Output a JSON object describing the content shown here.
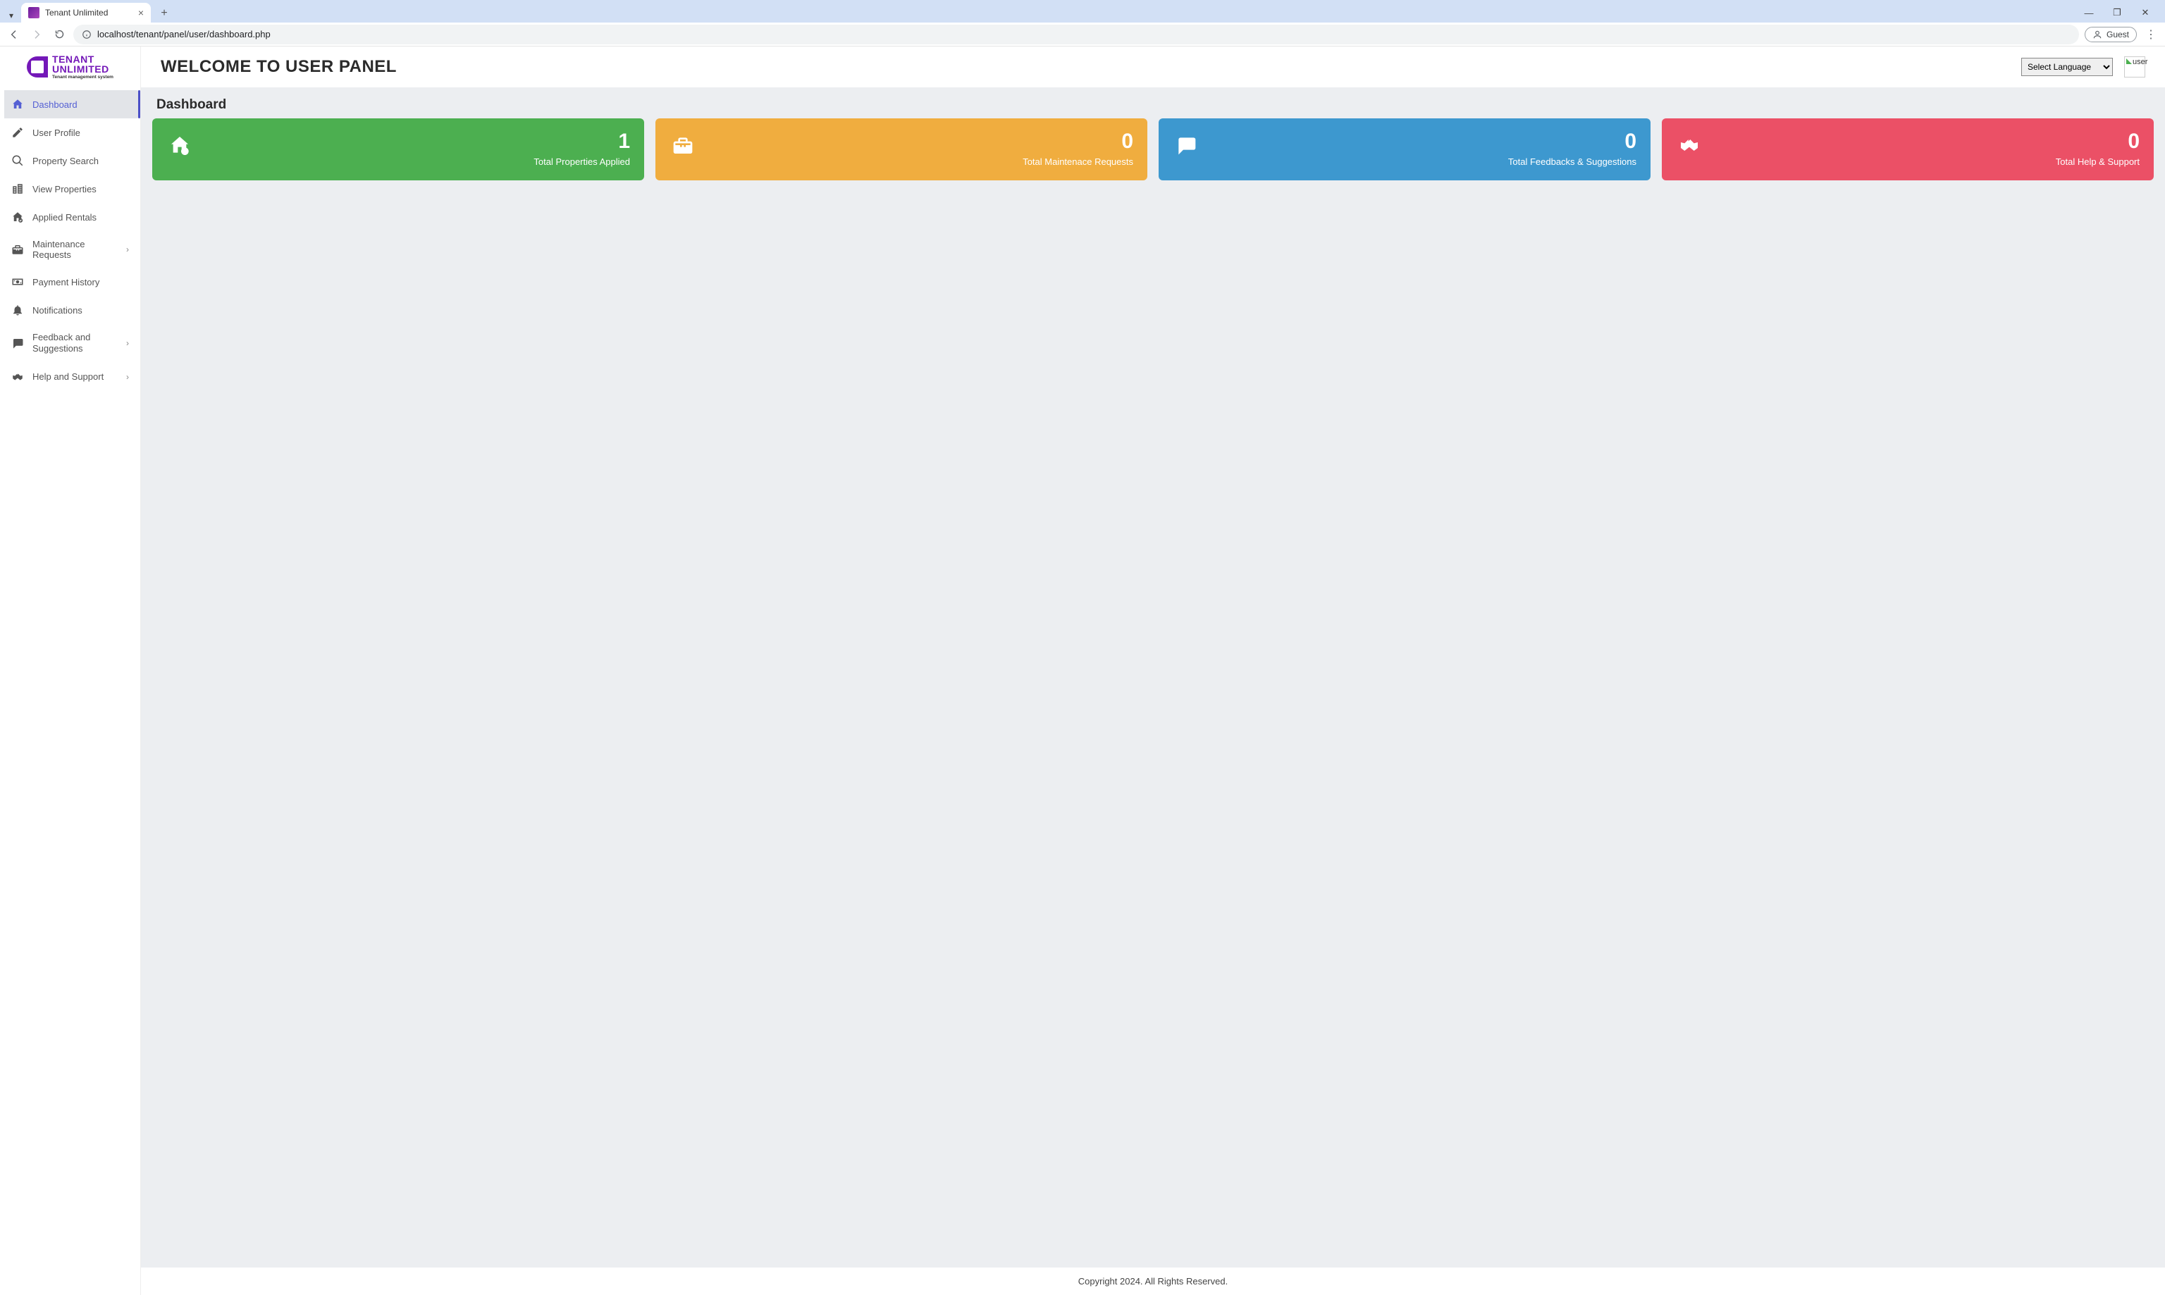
{
  "browser": {
    "tab_title": "Tenant Unlimited",
    "url": "localhost/tenant/panel/user/dashboard.php",
    "guest_label": "Guest"
  },
  "logo": {
    "line1": "TENANT",
    "line2": "UNLIMITED",
    "tagline": "Tenant management system"
  },
  "sidebar": {
    "items": [
      {
        "label": "Dashboard",
        "icon": "home-icon",
        "active": true,
        "has_submenu": false
      },
      {
        "label": "User Profile",
        "icon": "pencil-icon",
        "active": false,
        "has_submenu": false
      },
      {
        "label": "Property Search",
        "icon": "search-icon",
        "active": false,
        "has_submenu": false
      },
      {
        "label": "View Properties",
        "icon": "buildings-icon",
        "active": false,
        "has_submenu": false
      },
      {
        "label": "Applied Rentals",
        "icon": "home-check-icon",
        "active": false,
        "has_submenu": false
      },
      {
        "label": "Maintenance Requests",
        "icon": "toolbox-icon",
        "active": false,
        "has_submenu": true
      },
      {
        "label": "Payment History",
        "icon": "money-icon",
        "active": false,
        "has_submenu": false
      },
      {
        "label": "Notifications",
        "icon": "bell-icon",
        "active": false,
        "has_submenu": false
      },
      {
        "label": "Feedback and Suggestions",
        "icon": "comment-icon",
        "active": false,
        "has_submenu": true
      },
      {
        "label": "Help and Support",
        "icon": "handshake-icon",
        "active": false,
        "has_submenu": true
      }
    ]
  },
  "header": {
    "welcome": "WELCOME TO USER PANEL",
    "language_select": "Select Language",
    "avatar_alt": "user"
  },
  "page": {
    "title": "Dashboard"
  },
  "cards": [
    {
      "value": "1",
      "label": "Total Properties Applied",
      "color": "c-green",
      "icon": "home-check-icon"
    },
    {
      "value": "0",
      "label": "Total Maintenace Requests",
      "color": "c-yellow",
      "icon": "toolbox-icon"
    },
    {
      "value": "0",
      "label": "Total Feedbacks & Suggestions",
      "color": "c-blue",
      "icon": "comment-icon"
    },
    {
      "value": "0",
      "label": "Total Help & Support",
      "color": "c-red",
      "icon": "handshake-icon"
    }
  ],
  "footer": "Copyright 2024. All Rights Reserved."
}
